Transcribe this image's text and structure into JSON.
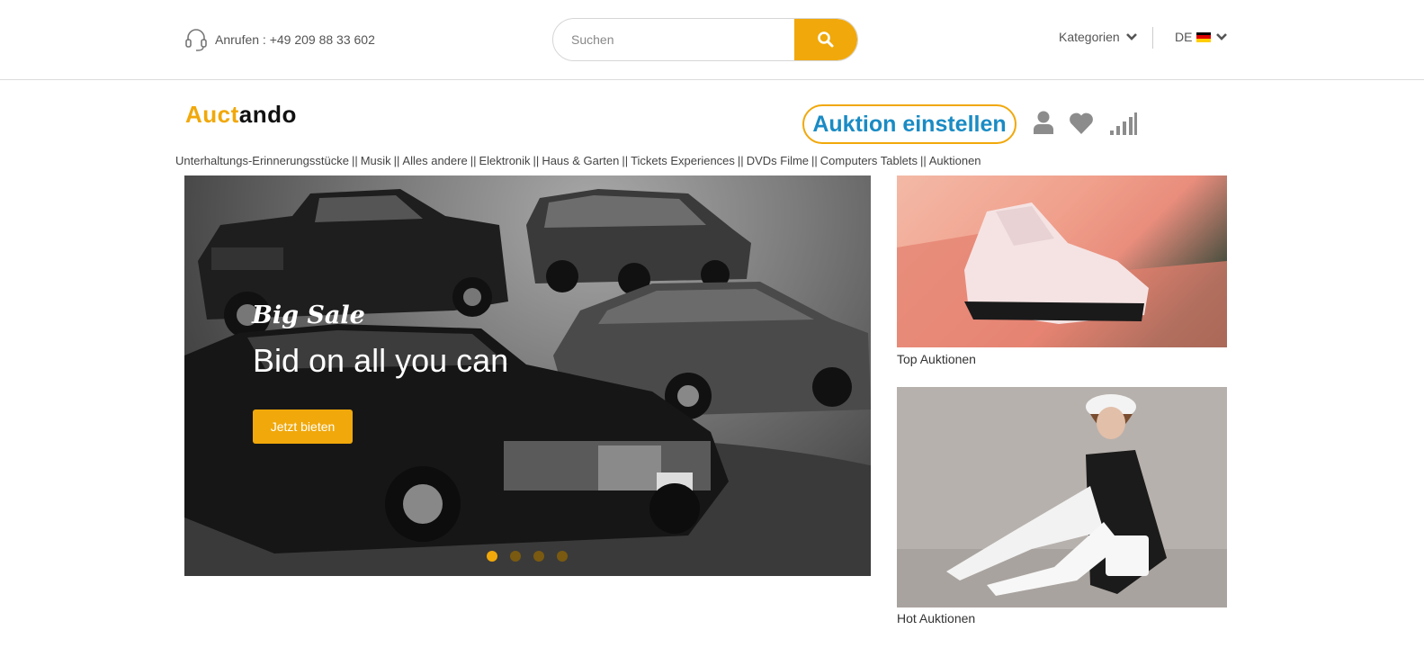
{
  "topbar": {
    "phone_text": "Anrufen : +49 209 88 33 602",
    "search_placeholder": "Suchen",
    "categories_label": "Kategorien",
    "lang_label": "DE"
  },
  "header": {
    "logo_part1": "Auct",
    "logo_part2": "ando",
    "auktion_button": "Auktion einstellen"
  },
  "nav": {
    "items": [
      "Unterhaltungs-Erinnerungsstücke",
      "Musik",
      "Alles andere",
      "Elektronik",
      "Haus & Garten",
      "Tickets Experiences",
      "DVDs Filme",
      "Computers Tablets",
      "Auktionen"
    ],
    "separator": "||"
  },
  "hero": {
    "subtitle": "Big Sale",
    "title": "Bid on all you can",
    "button": "Jetzt bieten",
    "slides": 4,
    "active_slide": 1
  },
  "cards": {
    "top_label": "Top Auktionen",
    "hot_label": "Hot Auktionen"
  },
  "colors": {
    "accent": "#f1a80a",
    "link_blue": "#1a8bc4",
    "icon_gray": "#8c8c8c"
  }
}
